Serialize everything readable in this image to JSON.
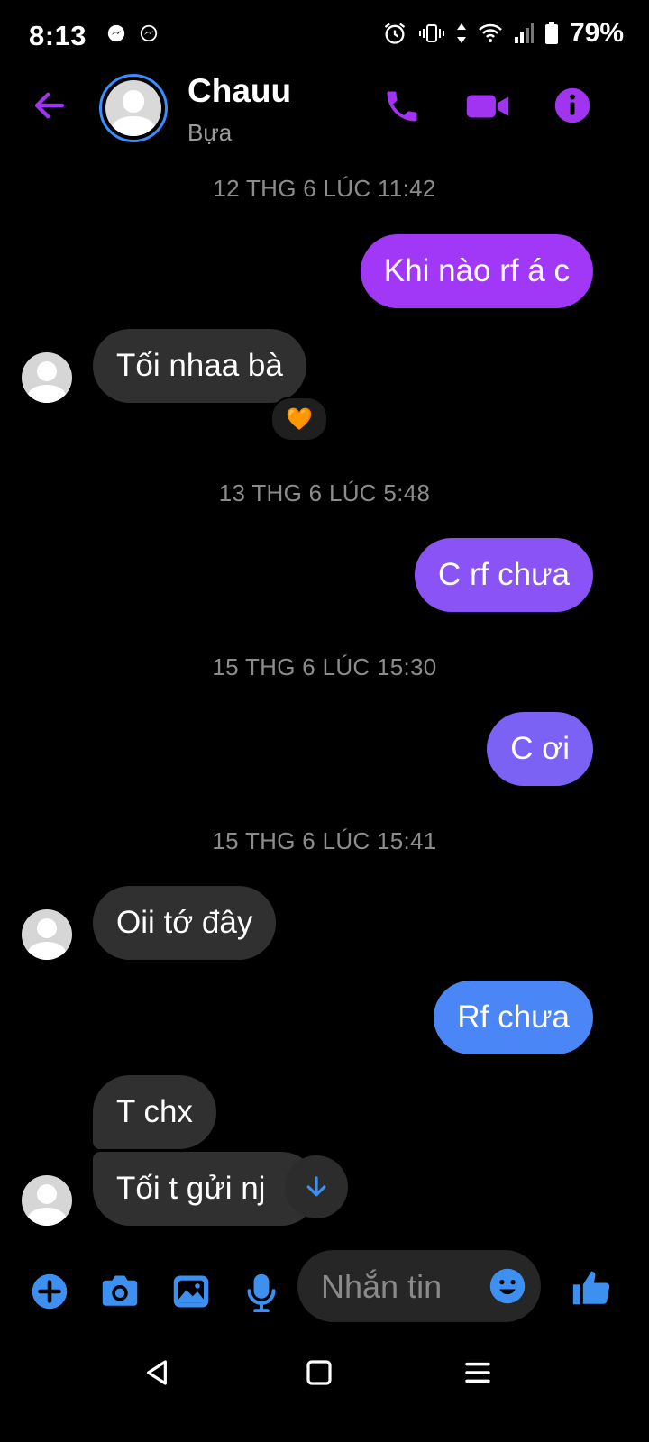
{
  "status_bar": {
    "time": "8:13",
    "battery": "79%",
    "icons": [
      "messenger-icon",
      "messenger-icon",
      "alarm-icon",
      "vibrate-icon",
      "data-arrows-icon",
      "wifi-icon",
      "signal-icon",
      "battery-icon"
    ]
  },
  "header": {
    "contact_name": "Chauu",
    "contact_status": "Bựa",
    "actions": [
      "back-arrow-icon",
      "phone-icon",
      "video-icon",
      "info-icon"
    ],
    "accent_color": "#a034f0"
  },
  "conversation": [
    {
      "type": "timestamp",
      "text": "12 THG 6 LÚC 11:42"
    },
    {
      "type": "outgoing",
      "text": "Khi nào rf á c",
      "color": "#a238f7"
    },
    {
      "type": "incoming",
      "text": "Tối nhaa bà",
      "reaction": "🧡"
    },
    {
      "type": "timestamp",
      "text": "13 THG 6 LÚC 5:48"
    },
    {
      "type": "outgoing",
      "text": "C rf chưa",
      "color": "#8a53f5"
    },
    {
      "type": "timestamp",
      "text": "15 THG 6 LÚC 15:30"
    },
    {
      "type": "outgoing",
      "text": "C ơi",
      "color": "#7b62f4"
    },
    {
      "type": "timestamp",
      "text": "15 THG 6 LÚC 15:41"
    },
    {
      "type": "incoming",
      "text": "Oii tớ đây"
    },
    {
      "type": "outgoing",
      "text": "Rf chưa",
      "color": "#4b86f7"
    },
    {
      "type": "incoming",
      "text": "T chx"
    },
    {
      "type": "incoming",
      "text": "Tối t gửi nj"
    }
  ],
  "composer": {
    "placeholder": "Nhắn tin",
    "tools": [
      "plus-icon",
      "camera-icon",
      "gallery-icon",
      "microphone-icon",
      "emoji-icon",
      "like-icon"
    ],
    "tool_color": "#3d8ff0"
  },
  "nav_bar": [
    "back-triangle-icon",
    "home-square-icon",
    "menu-icon"
  ]
}
